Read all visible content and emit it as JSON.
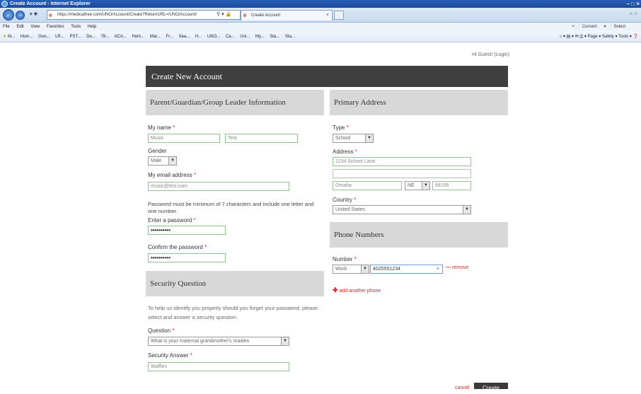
{
  "browser": {
    "window_title": "Create Account - Internet Explorer",
    "url": "https://medicaltree.com/UNO/Account/Create?ReturnURL=/UNO/Account/",
    "tab_title": "Create Account",
    "menu": [
      "File",
      "Edit",
      "View",
      "Favorites",
      "Tools",
      "Help"
    ],
    "convert_label": "Convert",
    "select_label": "Select",
    "favorites": [
      "M...",
      "Hom...",
      "Goo...",
      "LR...",
      "PST...",
      "De...",
      "78...",
      "ACA...",
      "Hom...",
      "Mar...",
      "Fr...",
      "Sea...",
      "H...",
      "UNO...",
      "Ca...",
      "Uni...",
      "My...",
      "Sta...",
      "Sta..."
    ],
    "cmd_right": [
      "Page",
      "Safety",
      "Tools"
    ]
  },
  "greeting": {
    "text": "Hi Guest!",
    "login": "(Login)"
  },
  "page_title": "Create New Account",
  "guardian": {
    "heading": "Parent/Guardian/Group Leader Information",
    "name_label": "My name",
    "first_name": "Music",
    "last_name": "Test",
    "gender_label": "Gender",
    "gender": "Male",
    "email_label": "My email address",
    "email": "music@test.com",
    "password_rule": "Password must be minimum of 7 characters and include one letter and one number.",
    "password_label": "Enter a password",
    "password_mask": "••••••••••",
    "confirm_label": "Confirm the password",
    "confirm_mask": "••••••••••"
  },
  "security": {
    "heading": "Security Question",
    "help": "To help us identify you properly should you forget your password, please select and answer a security question.",
    "question_label": "Question",
    "question": "What is your maternal grandmother's maiden",
    "answer_label": "Security Answer",
    "answer": "Waffles"
  },
  "address": {
    "heading": "Primary Address",
    "type_label": "Type",
    "type": "School",
    "address_label": "Address",
    "line1": "1234 School Lane",
    "line2": "",
    "city": "Omaha",
    "state": "NE",
    "zip": "68106",
    "country_label": "Country",
    "country": "United States"
  },
  "phones": {
    "heading": "Phone Numbers",
    "number_label": "Number",
    "type": "Work",
    "number": "4025551234",
    "remove_label": "remove",
    "add_label": "add another phone"
  },
  "actions": {
    "cancel": "cancel",
    "create": "Create"
  },
  "required_mark": "*"
}
